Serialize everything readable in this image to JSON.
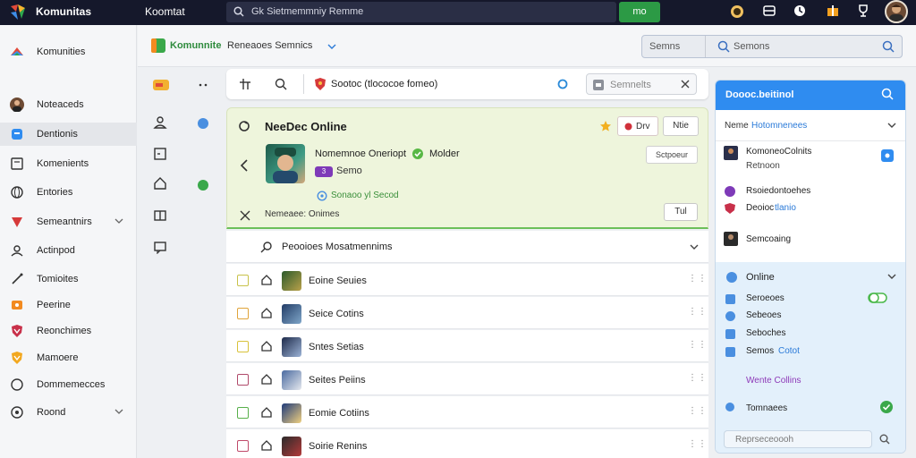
{
  "topbar": {
    "brand": "Komunitas",
    "title": "Koomtat",
    "search_text": "Gk Sietmemmniy Remme",
    "go_label": "mo"
  },
  "sidebar": {
    "items": [
      {
        "label": "Komunities",
        "icon": "brand-logo-icon"
      },
      {
        "label": "Noteaceds",
        "icon": "avatar-icon"
      },
      {
        "label": "Dentionis",
        "icon": "blue-chat-icon"
      },
      {
        "label": "Komenients",
        "icon": "square-icon"
      },
      {
        "label": "Entories",
        "icon": "globe-icon"
      },
      {
        "label": "Semeantnirs",
        "icon": "heart-shield-icon"
      },
      {
        "label": "Actinpod",
        "icon": "people-icon"
      },
      {
        "label": "Tomioites",
        "icon": "pen-icon"
      },
      {
        "label": "Peerine",
        "icon": "orange-badge-icon"
      },
      {
        "label": "Reonchimes",
        "icon": "red-shield-icon"
      },
      {
        "label": "Mamoere",
        "icon": "gold-shield-icon"
      },
      {
        "label": "Dommemecces",
        "icon": "circle-icon"
      },
      {
        "label": "Roond",
        "icon": "target-icon"
      }
    ]
  },
  "subhead": {
    "app_name": "Komunnite",
    "app_section": "Reneaoes Semnics",
    "search_left": "Semns",
    "search_right": "Semons"
  },
  "toolbar": {
    "title": "Sootoc (tlococoe fomeo)",
    "input_placeholder": "Semnelts"
  },
  "feature": {
    "title": "NeeDec Online",
    "btn1": "Drv",
    "btn2": "Ntie",
    "player_name": "Nomemnoe Oneriopt",
    "player_mode": "Molder",
    "tag": "3",
    "tag_text": "Semo",
    "status": "Sonaoo yl Secod",
    "right_btn": "Sctpoeur",
    "sub_text": "Nemeaee: Onimes",
    "right_btn2": "Tul"
  },
  "list": {
    "header": "Peooioes Mosatmennims",
    "rows": [
      {
        "name": "Eoine Seuies",
        "check_color": "#c8c24a",
        "thumb": [
          "#2b5a2b",
          "#b9a14a"
        ]
      },
      {
        "name": "Seice Cotins",
        "check_color": "#e0a43a",
        "thumb": [
          "#223c66",
          "#7fa6c9"
        ]
      },
      {
        "name": "Sntes Setias",
        "check_color": "#d8c23a",
        "thumb": [
          "#1d2a4a",
          "#9cb3d6"
        ]
      },
      {
        "name": "Seites Peiins",
        "check_color": "#b04a6a",
        "thumb": [
          "#4a6aa0",
          "#e5e8ee"
        ]
      },
      {
        "name": "Eomie Cotiins",
        "check_color": "#58b04a",
        "thumb": [
          "#1e3a7a",
          "#f0d080"
        ]
      },
      {
        "name": "Soirie Renins",
        "check_color": "#c04a6a",
        "thumb": [
          "#2a2a2a",
          "#b33a3a"
        ]
      }
    ]
  },
  "rpanel": {
    "title": "Doooc.beitinol",
    "filter_label": "Neme",
    "filter_value": "Hotomnenees",
    "items": [
      {
        "name": "KomoneoColnits",
        "sub": "Retnoon"
      },
      {
        "name": "Rsoiedontoehes",
        "sub": ""
      },
      {
        "name": "Deoioc",
        "sub": "tlanio"
      },
      {
        "name": "Semcoaing",
        "sub": ""
      }
    ],
    "online_label": "Online",
    "online_list": [
      "Seroeoes",
      "Sebeoes",
      "Seboches",
      "Semos",
      "Wente Collins"
    ],
    "online_extra": "Cotot",
    "bottom_item": "Tomnaees",
    "footer_placeholder": "Reprseceoooh"
  }
}
